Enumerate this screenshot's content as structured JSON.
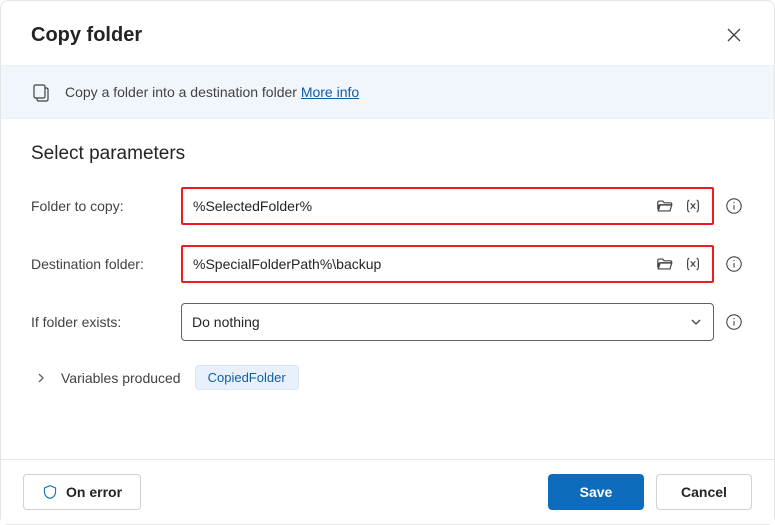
{
  "header": {
    "title": "Copy folder"
  },
  "banner": {
    "text": "Copy a folder into a destination folder ",
    "link": "More info"
  },
  "section_title": "Select parameters",
  "fields": {
    "folder_to_copy": {
      "label": "Folder to copy:",
      "value": "%SelectedFolder%"
    },
    "destination_folder": {
      "label": "Destination folder:",
      "value": "%SpecialFolderPath%\\backup"
    },
    "if_exists": {
      "label": "If folder exists:",
      "value": "Do nothing"
    }
  },
  "variables": {
    "label": "Variables produced",
    "chip": "CopiedFolder"
  },
  "footer": {
    "on_error": "On error",
    "save": "Save",
    "cancel": "Cancel"
  }
}
